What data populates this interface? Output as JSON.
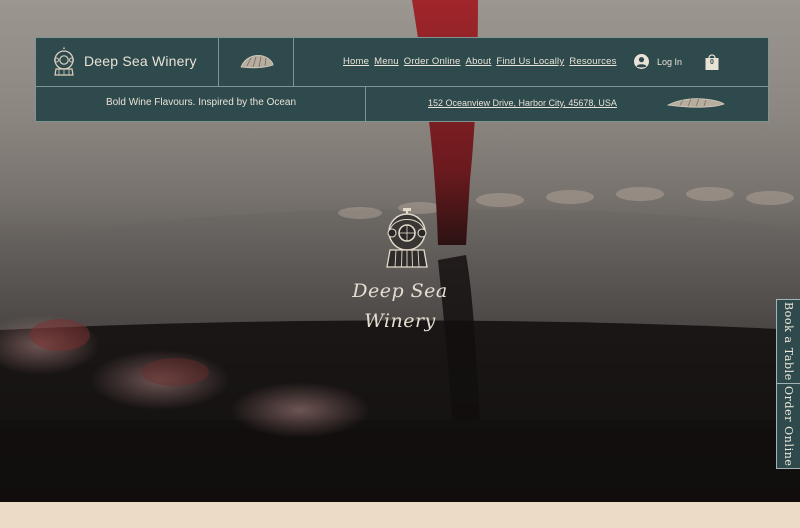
{
  "brand": {
    "name": "Deep Sea Winery",
    "tagline": "Bold Wine Flavours. Inspired by the Ocean"
  },
  "nav": {
    "items": [
      {
        "label": "Home"
      },
      {
        "label": "Menu"
      },
      {
        "label": "Order Online"
      },
      {
        "label": "About"
      },
      {
        "label": "Find Us Locally"
      },
      {
        "label": "Resources"
      }
    ],
    "login_label": "Log In",
    "cart_count": "0"
  },
  "address": "152 Oceanview Drive, Harbor City, 45678, USA",
  "hero": {
    "script_line1": "Deep Sea",
    "script_line2": "Winery"
  },
  "side_tabs": {
    "book": "Book a Table",
    "order": "Order Online"
  },
  "icons": {
    "brand": "diving-helmet-icon",
    "shell": "seashell-icon",
    "user": "user-avatar-icon",
    "cart": "shopping-bag-icon"
  },
  "colors": {
    "header_bg": "#2e4a4d",
    "header_border": "#7d9694",
    "text_light": "#e9e3d6",
    "wine_red": "#8e1c22",
    "cream": "#ecdcc6"
  }
}
